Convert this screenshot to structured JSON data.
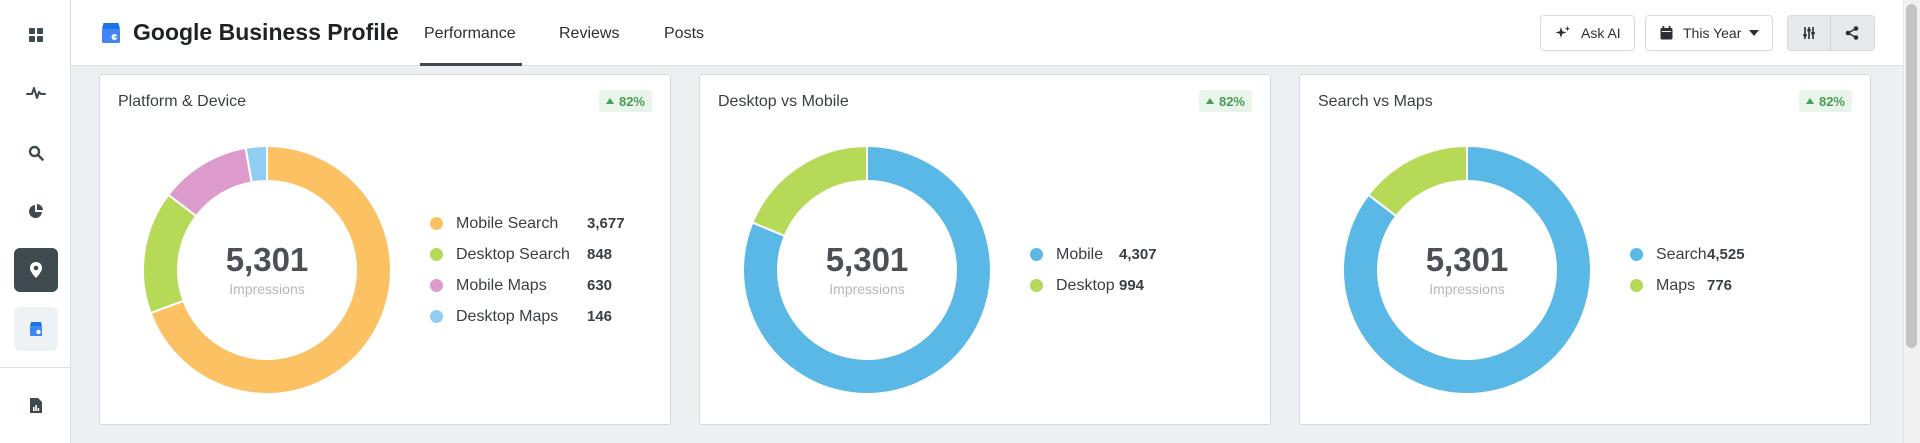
{
  "header": {
    "title": "Google Business Profile",
    "tabs": [
      {
        "label": "Performance"
      },
      {
        "label": "Reviews"
      },
      {
        "label": "Posts"
      }
    ],
    "ask_ai_label": "Ask AI",
    "date_range_label": "This Year"
  },
  "sidebar": {
    "icons": [
      "grid-icon",
      "pulse-icon",
      "search-icon",
      "pie-chart-icon",
      "map-pin-icon",
      "business-profile-icon",
      "report-icon"
    ]
  },
  "cards": [
    {
      "title": "Platform & Device",
      "badge": "82%",
      "center_value": "5,301",
      "center_label": "Impressions",
      "legend": [
        {
          "label": "Mobile Search",
          "value": "3,677",
          "color": "#fbc163"
        },
        {
          "label": "Desktop Search",
          "value": "848",
          "color": "#b6d957"
        },
        {
          "label": "Mobile Maps",
          "value": "630",
          "color": "#dd9acc"
        },
        {
          "label": "Desktop Maps",
          "value": "146",
          "color": "#8fcdf2"
        }
      ]
    },
    {
      "title": "Desktop vs Mobile",
      "badge": "82%",
      "center_value": "5,301",
      "center_label": "Impressions",
      "legend": [
        {
          "label": "Mobile",
          "value": "4,307",
          "color": "#5ab8e6"
        },
        {
          "label": "Desktop",
          "value": "994",
          "color": "#b6d957"
        }
      ]
    },
    {
      "title": "Search vs Maps",
      "badge": "82%",
      "center_value": "5,301",
      "center_label": "Impressions",
      "legend": [
        {
          "label": "Search",
          "value": "4,525",
          "color": "#5ab8e6"
        },
        {
          "label": "Maps",
          "value": "776",
          "color": "#b6d957"
        }
      ]
    }
  ],
  "chart_data": [
    {
      "type": "pie",
      "categories": [
        "Mobile Search",
        "Desktop Search",
        "Mobile Maps",
        "Desktop Maps"
      ],
      "values": [
        3677,
        848,
        630,
        146
      ],
      "title": "Platform & Device"
    },
    {
      "type": "pie",
      "categories": [
        "Mobile",
        "Desktop"
      ],
      "values": [
        4307,
        994
      ],
      "title": "Desktop vs Mobile"
    },
    {
      "type": "pie",
      "categories": [
        "Search",
        "Maps"
      ],
      "values": [
        4525,
        776
      ],
      "title": "Search vs Maps"
    }
  ]
}
